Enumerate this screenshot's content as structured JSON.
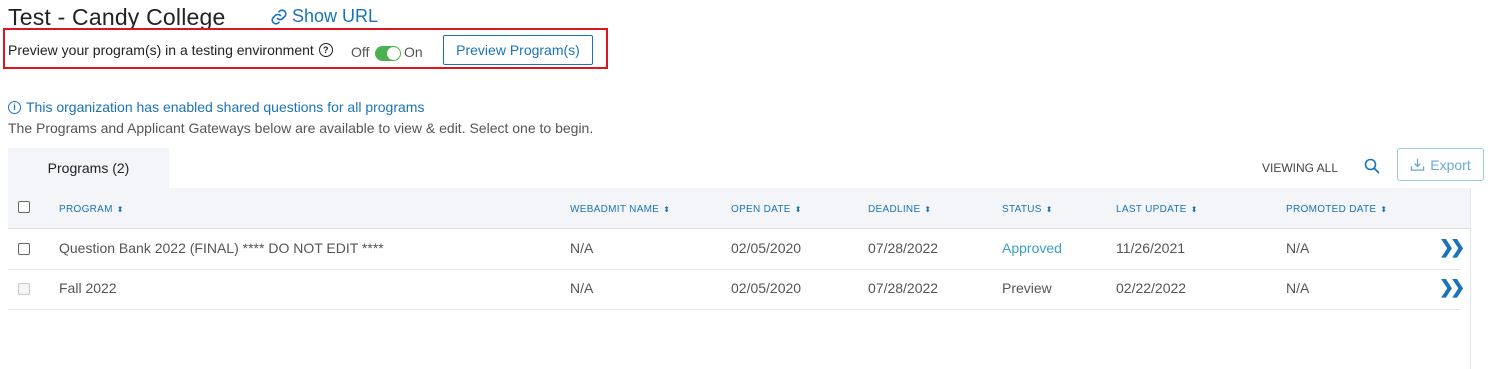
{
  "header": {
    "title": "Test - Candy College",
    "show_url": "Show URL"
  },
  "preview": {
    "label": "Preview your program(s) in a testing environment",
    "toggle_off": "Off",
    "toggle_on": "On",
    "toggle_state": "on",
    "button": "Preview Program(s)"
  },
  "info": {
    "shared_questions": "This organization has enabled shared questions for all programs",
    "description": "The Programs and Applicant Gateways below are available to view & edit. Select one to begin."
  },
  "tabs": [
    {
      "label": "Programs (2)"
    }
  ],
  "toolbar": {
    "viewing": "VIEWING ALL",
    "export": "Export"
  },
  "table": {
    "columns": [
      "PROGRAM",
      "WEBADMIT NAME",
      "OPEN DATE",
      "DEADLINE",
      "STATUS",
      "LAST UPDATE",
      "PROMOTED DATE"
    ],
    "rows": [
      {
        "program": "Question Bank 2022 (FINAL) **** DO NOT EDIT ****",
        "webadmit": "N/A",
        "open": "02/05/2020",
        "deadline": "07/28/2022",
        "status": "Approved",
        "last_update": "11/26/2021",
        "promoted": "N/A"
      },
      {
        "program": "Fall 2022",
        "webadmit": "N/A",
        "open": "02/05/2020",
        "deadline": "07/28/2022",
        "status": "Preview",
        "last_update": "02/22/2022",
        "promoted": "N/A"
      }
    ]
  },
  "colors": {
    "accent": "#1a73b8",
    "toggle_on": "#4caf50",
    "highlight": "#e0141e",
    "status_approved": "#3aa0c4"
  }
}
